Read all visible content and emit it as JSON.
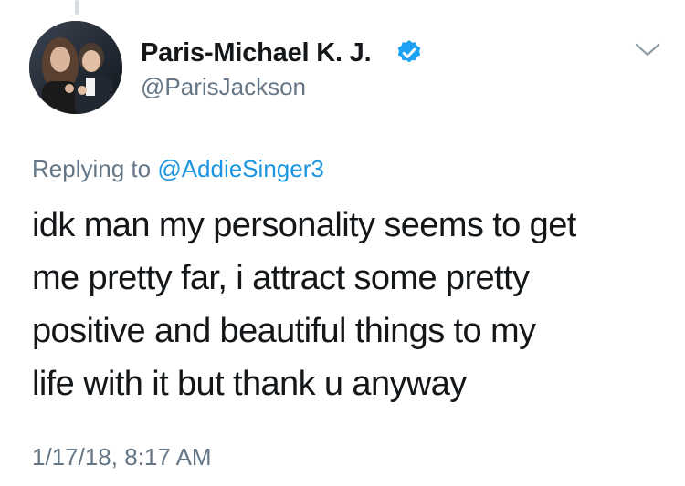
{
  "author": {
    "display_name": "Paris-Michael K. J.",
    "handle": "@ParisJackson",
    "verified_icon": "verified-badge-icon",
    "avatar": "profile-photo"
  },
  "reply_context": {
    "prefix": "Replying to",
    "mention": "@AddieSinger3"
  },
  "tweet": {
    "lines": [
      "idk man my personality seems to get",
      "me pretty far, i attract some pretty",
      "positive and beautiful things to my",
      "life with it but thank u anyway"
    ]
  },
  "meta": {
    "timestamp": "1/17/18, 8:17 AM"
  },
  "menu_icon": "chevron-down-icon",
  "colors": {
    "text": "#14171a",
    "secondary": "#657786",
    "link": "#1b95e0",
    "verified": "#1da1f2"
  }
}
